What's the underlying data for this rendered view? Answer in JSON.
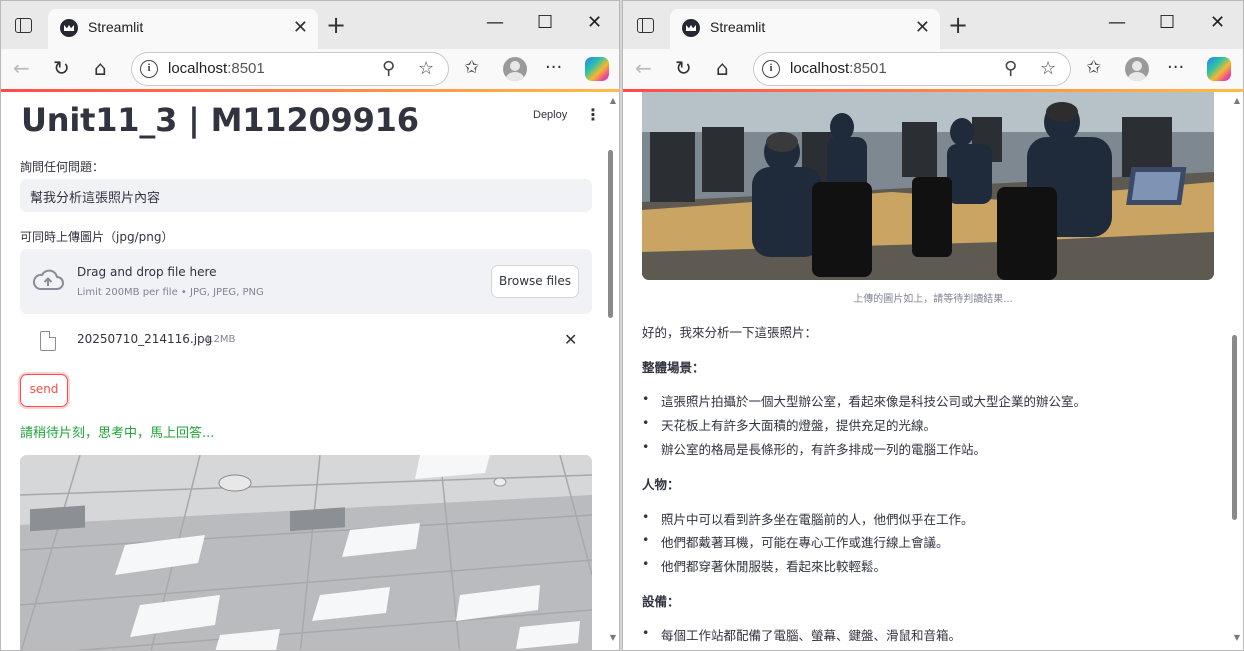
{
  "browser": {
    "tab_title": "Streamlit",
    "url_host": "localhost",
    "url_port": ":8501"
  },
  "left": {
    "page_title": "Unit11_3 | M11209916",
    "deploy_label": "Deploy",
    "question_label": "詢問任何問題：",
    "question_value": "幫我分析這張照片內容",
    "upload_label": "可同時上傳圖片（jpg/png）",
    "dropzone_title": "Drag and drop file here",
    "dropzone_hint": "Limit 200MB per file • JPG, JPEG, PNG",
    "browse_label": "Browse files",
    "file_name": "20250710_214116.jpg",
    "file_size": "4.2MB",
    "send_label": "send",
    "waiting_text": "請稍待片刻，思考中，馬上回答..."
  },
  "right": {
    "image_caption": "上傳的圖片如上，請等待判讀結果...",
    "intro": "好的，我來分析一下這張照片：",
    "sections": [
      {
        "heading": "整體場景：",
        "items": [
          "這張照片拍攝於一個大型辦公室，看起來像是科技公司或大型企業的辦公室。",
          "天花板上有許多大面積的燈盤，提供充足的光線。",
          "辦公室的格局是長條形的，有許多排成一列的電腦工作站。"
        ]
      },
      {
        "heading": "人物：",
        "items": [
          "照片中可以看到許多坐在電腦前的人，他們似乎在工作。",
          "他們都戴著耳機，可能在專心工作或進行線上會議。",
          "他們都穿著休閒服裝，看起來比較輕鬆。"
        ]
      },
      {
        "heading": "設備：",
        "items": [
          "每個工作站都配備了電腦、螢幕、鍵盤、滑鼠和音箱。"
        ]
      }
    ]
  },
  "colors": {
    "accent": "#ff4b4b",
    "waiting_green": "#21a539",
    "input_bg": "#f0f2f6"
  }
}
